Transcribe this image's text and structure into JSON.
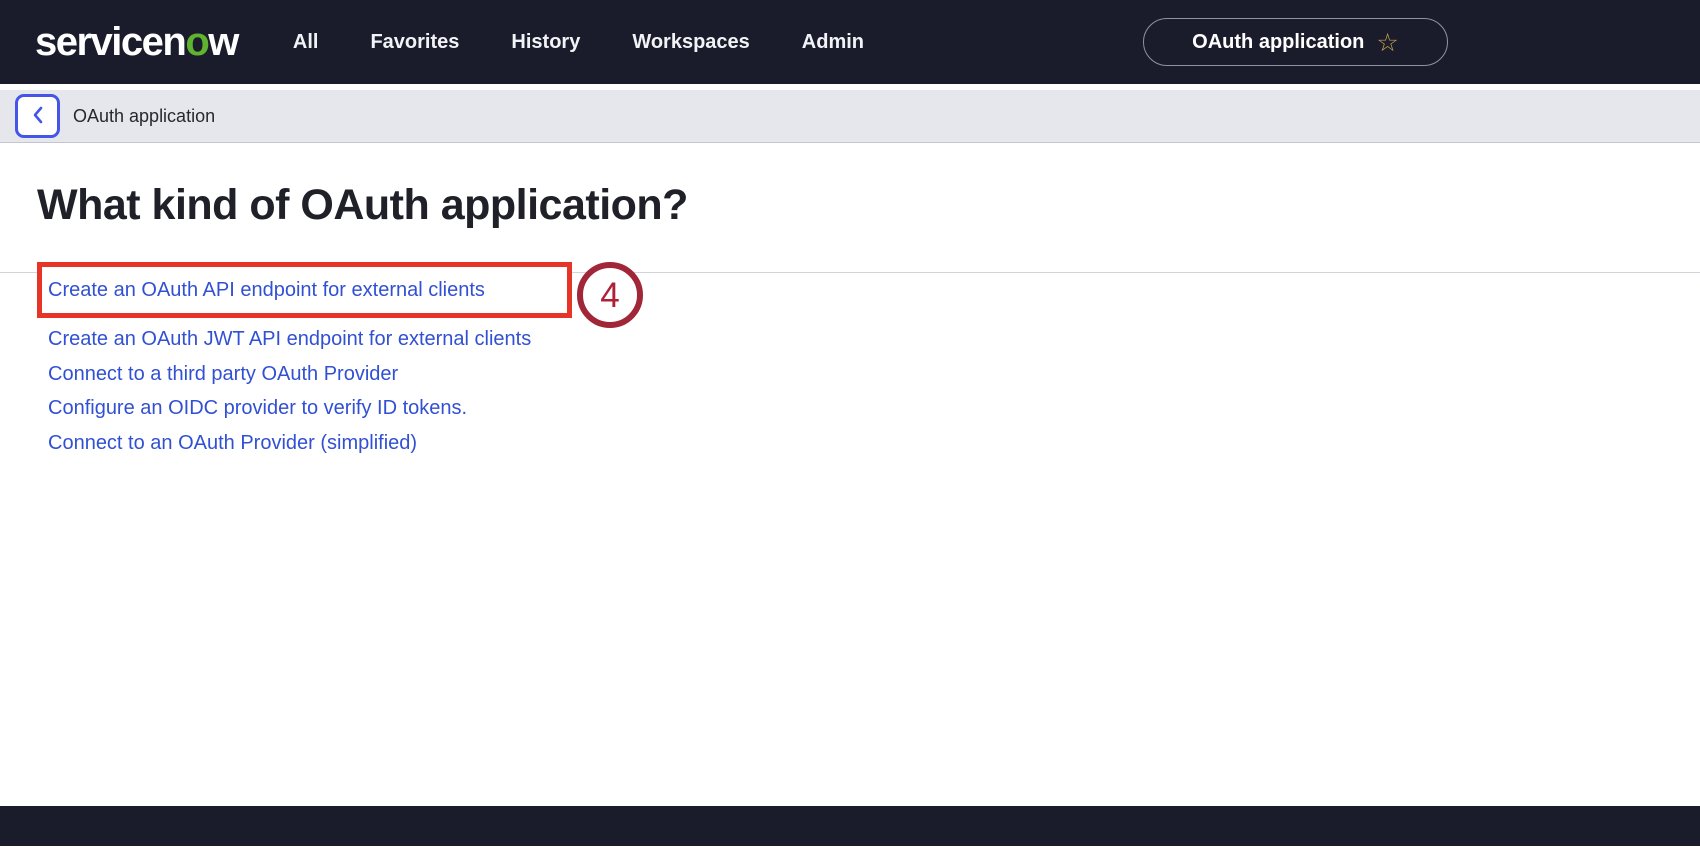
{
  "nav": {
    "logo": {
      "prefix": "servicen",
      "green_letter": "o",
      "suffix": "w"
    },
    "items": [
      "All",
      "Favorites",
      "History",
      "Workspaces",
      "Admin"
    ],
    "pill": {
      "label": "OAuth application",
      "star_icon": "☆"
    }
  },
  "breadcrumb": {
    "label": "OAuth application"
  },
  "main": {
    "heading": "What kind of OAuth application?",
    "links": [
      "Create an OAuth API endpoint for external clients",
      "Create an OAuth JWT API endpoint for external clients",
      "Connect to a third party OAuth Provider",
      "Configure an OIDC provider to verify ID tokens.",
      "Connect to an OAuth Provider (simplified)"
    ],
    "annotation": {
      "step_number": "4"
    }
  },
  "colors": {
    "nav_background": "#1a1c2b",
    "logo_green": "#5fb32e",
    "star_gold": "#c9a352",
    "breadcrumb_background": "#e6e6ed",
    "back_button_blue": "#4455e8",
    "link_blue": "#3150d3",
    "highlight_red": "#e63528",
    "badge_ring_red": "#a02638"
  }
}
